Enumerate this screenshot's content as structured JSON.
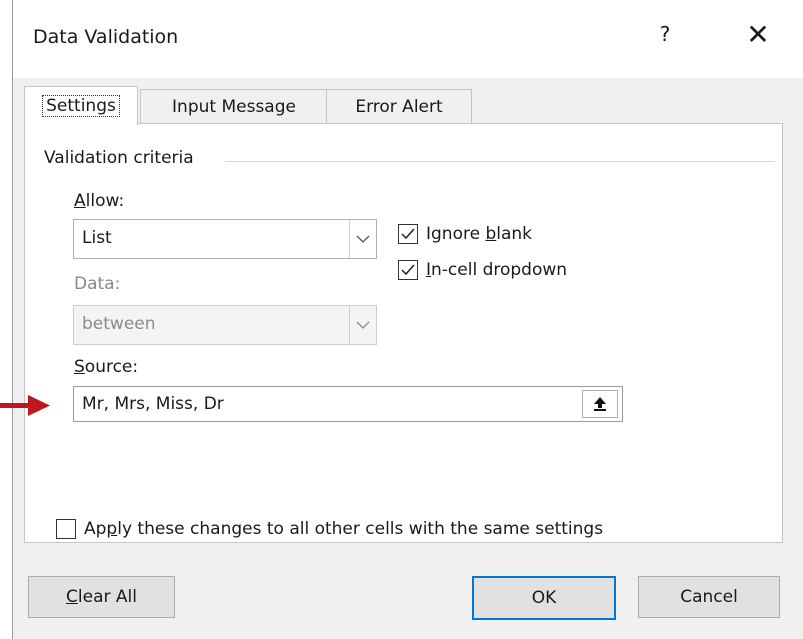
{
  "window": {
    "title": "Data Validation",
    "help_label": "?",
    "close_label": "✕"
  },
  "tabs": [
    {
      "label": "Settings",
      "active": true
    },
    {
      "label": "Input Message",
      "active": false
    },
    {
      "label": "Error Alert",
      "active": false
    }
  ],
  "criteria": {
    "group_title": "Validation criteria",
    "allow": {
      "label_first": "A",
      "label_rest": "llow:",
      "value": "List"
    },
    "data": {
      "label": "Data:",
      "value": "between"
    },
    "ignore_blank": {
      "label_pre": "Ignore ",
      "label_u": "b",
      "label_post": "lank",
      "checked": true
    },
    "incell_dropdown": {
      "label_u": "I",
      "label_post": "n-cell dropdown",
      "checked": true
    },
    "source": {
      "label_u": "S",
      "label_rest": "ource:",
      "value": "Mr, Mrs, Miss, Dr"
    }
  },
  "apply_all": {
    "label_pre": "Ap",
    "label_u": "p",
    "label_post": "ly these changes to all other cells with the same settings",
    "checked": false
  },
  "buttons": {
    "clear_all_u": "C",
    "clear_all_rest": "lear All",
    "ok": "OK",
    "cancel": "Cancel"
  },
  "colors": {
    "annotation_arrow": "#c0161e",
    "default_button_border": "#0078d7"
  }
}
